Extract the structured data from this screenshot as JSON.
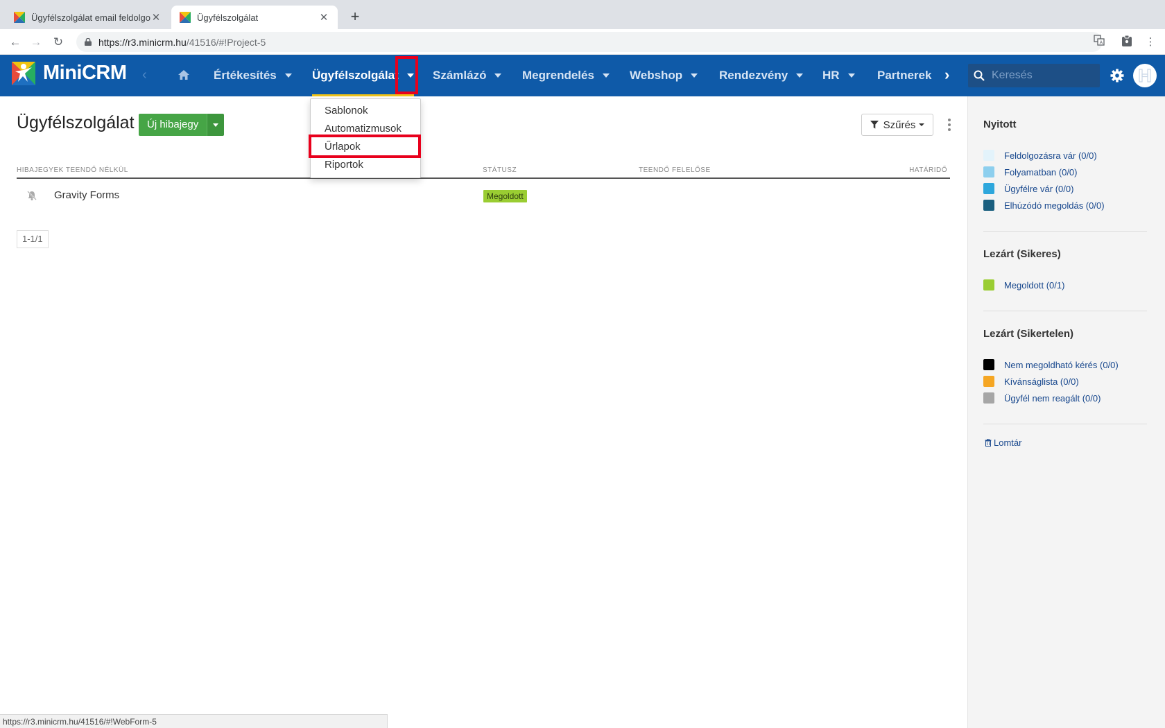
{
  "browser": {
    "tabs": [
      {
        "title": "Ügyfélszolgálat email feldolgoz",
        "active": false
      },
      {
        "title": "Ügyfélszolgálat",
        "active": true
      }
    ],
    "url_host": "https://r3.minicrm.hu",
    "url_path": "/41516/#!Project-5",
    "status_url": "https://r3.minicrm.hu/41516/#!WebForm-5"
  },
  "app": {
    "logo_text": "MiniCRM",
    "nav": [
      {
        "label": "Értékesítés",
        "active": false
      },
      {
        "label": "Ügyfélszolgálat",
        "active": true
      },
      {
        "label": "Számlázó",
        "active": false
      },
      {
        "label": "Megrendelés",
        "active": false
      },
      {
        "label": "Webshop",
        "active": false
      },
      {
        "label": "Rendezvény",
        "active": false
      },
      {
        "label": "HR",
        "active": false
      },
      {
        "label": "Partnerek",
        "active": false
      }
    ],
    "search_placeholder": "Keresés",
    "colors": {
      "header": "#0f5aa8",
      "active_underline": "#f0c419",
      "primary_button": "#46a546",
      "highlight": "#e8001c"
    }
  },
  "dropdown": {
    "items": [
      "Sablonok",
      "Automatizmusok",
      "Űrlapok",
      "Riportok"
    ],
    "highlighted": "Űrlapok"
  },
  "main": {
    "title": "Ügyfélszolgálat",
    "new_button": "Új hibajegy",
    "filter_button": "Szűrés",
    "columns": [
      "HIBAJEGYEK TEENDŐ NÉLKÜL",
      "STÁTUSZ",
      "TEENDŐ FELELŐSE",
      "HATÁRIDŐ"
    ],
    "rows": [
      {
        "title": "Gravity Forms",
        "status": "Megoldott",
        "status_color": "#9acd32"
      }
    ],
    "pager": "1-1/1"
  },
  "sidebar": {
    "groups": [
      {
        "title": "Nyitott",
        "items": [
          {
            "label": "Feldolgozásra vár (0/0)",
            "color": "#e3f3fb"
          },
          {
            "label": "Folyamatban (0/0)",
            "color": "#8dcfee"
          },
          {
            "label": "Ügyfélre vár (0/0)",
            "color": "#2ea7dc"
          },
          {
            "label": "Elhúzódó megoldás (0/0)",
            "color": "#1a5f7f"
          }
        ]
      },
      {
        "title": "Lezárt (Sikeres)",
        "items": [
          {
            "label": "Megoldott (0/1)",
            "color": "#9acd32"
          }
        ]
      },
      {
        "title": "Lezárt (Sikertelen)",
        "items": [
          {
            "label": "Nem megoldható kérés (0/0)",
            "color": "#000000"
          },
          {
            "label": "Kívánságlista (0/0)",
            "color": "#f5a623"
          },
          {
            "label": "Ügyfél nem reagált (0/0)",
            "color": "#a6a6a6"
          }
        ]
      }
    ],
    "trash": "Lomtár"
  }
}
